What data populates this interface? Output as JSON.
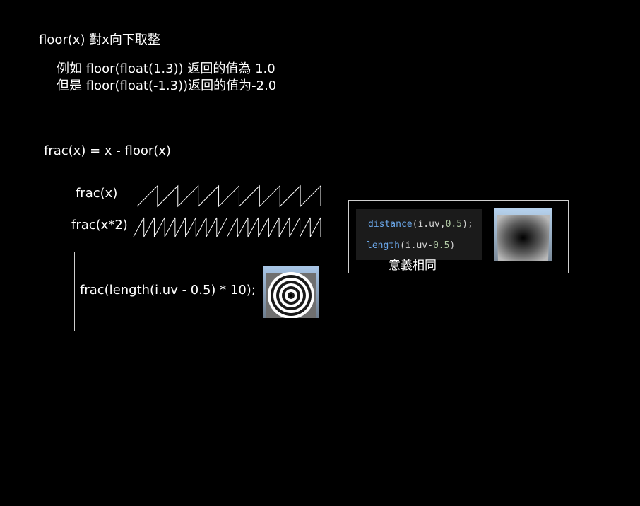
{
  "heading_floor": "floor(x) 對x向下取整",
  "example_line_1": "例如 floor(float(1.3)) 返回的值為 1.0",
  "example_line_2": "但是 floor(float(-1.3))返回的值为-2.0",
  "heading_frac": "frac(x) = x - floor(x)",
  "label_frac_x": "frac(x)",
  "label_frac_x2": "frac(x*2)",
  "rings_code": "frac(length(i.uv - 0.5) * 10);",
  "code_line_1": {
    "fn": "distance",
    "args_plain": "(i.uv,",
    "num": "0.5",
    "tail": ");"
  },
  "code_line_2": {
    "fn": "length",
    "args_plain": "(i.uv-",
    "num": "0.5",
    "tail": ")"
  },
  "same_meaning_caption": "意義相同",
  "colors": {
    "background": "#000000",
    "text": "#ffffff",
    "keyword": "#6aa6e8",
    "number": "#b5cea8",
    "code_bg": "#1b1b1b",
    "box_border": "#cfcfcf"
  },
  "sawtooth": {
    "frac_x_teeth": 9,
    "frac_x2_teeth": 18
  }
}
